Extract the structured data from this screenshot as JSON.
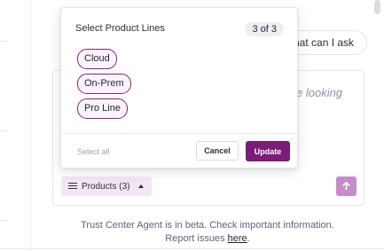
{
  "background": {
    "suggestion_chip_text": "hat can I ask",
    "composer_placeholder": "e looking"
  },
  "popover": {
    "title": "Select Product Lines",
    "count": "3 of 3",
    "options": [
      {
        "label": "Cloud",
        "selected": true
      },
      {
        "label": "On-Prem",
        "selected": true
      },
      {
        "label": "Pro Line",
        "selected": true
      }
    ],
    "select_all_label": "Select all",
    "cancel_label": "Cancel",
    "update_label": "Update"
  },
  "composer": {
    "products_chip_label": "Products (3)",
    "send_icon": "arrow-up-icon"
  },
  "footer": {
    "notice": "Trust Center Agent is in beta. Check important information.",
    "report_prefix": "Report issues ",
    "report_link": "here",
    "report_suffix": "."
  },
  "colors": {
    "accent": "#7a1d78",
    "chip_border": "#7a2a78",
    "chip_bg": "#fbf3fb",
    "products_chip_bg": "#f3e6f3",
    "send_button_bg": "#c58bcb"
  }
}
